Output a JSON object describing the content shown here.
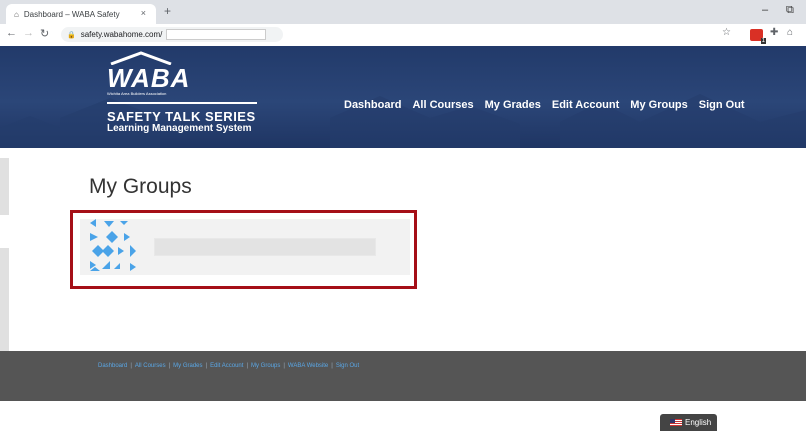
{
  "browser": {
    "tab_title": "Dashboard – WABA Safety",
    "tab_close": "×",
    "new_tab": "+",
    "url": "safety.wabahome.com/",
    "minimize": "–",
    "restore": "⧉",
    "ext_badge": "1"
  },
  "site": {
    "logo_word": "WABA",
    "logo_subtitle": "Wichita Area Builders Association",
    "logo_series": "SAFETY TALK SERIES",
    "logo_lms": "Learning Management System",
    "nav": [
      "Dashboard",
      "All Courses",
      "My Grades",
      "Edit Account",
      "My Groups",
      "Sign Out"
    ]
  },
  "page": {
    "title": "My Groups"
  },
  "footer": {
    "links": [
      "Dashboard",
      "All Courses",
      "My Grades",
      "Edit Account",
      "My Groups",
      "WABA Website",
      "Sign Out"
    ],
    "separator": "|"
  },
  "language": {
    "label": "English"
  },
  "colors": {
    "header_bg": "#2b4678",
    "highlight_border": "#a50f17",
    "footer_bg": "#555555",
    "footer_link": "#5aa7e6",
    "avatar_blue": "#4aa3e8"
  }
}
